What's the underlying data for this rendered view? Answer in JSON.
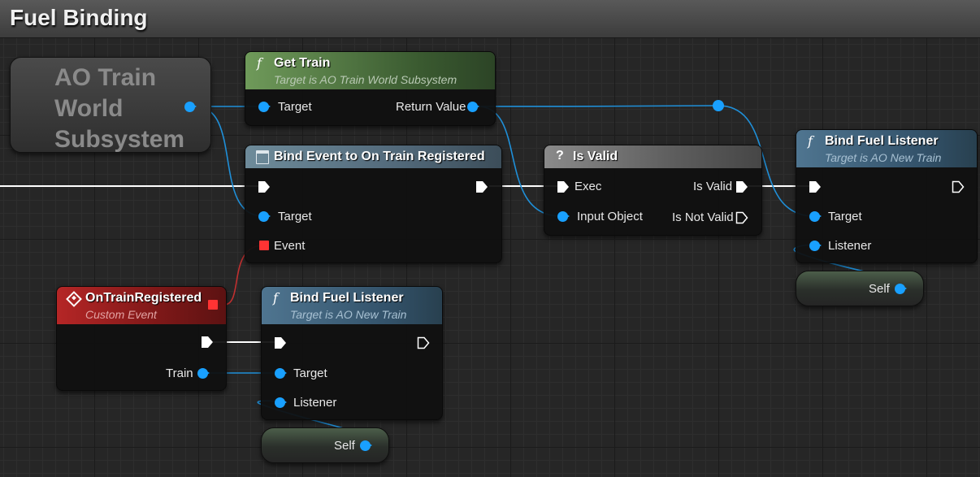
{
  "graph_title": "Fuel Binding",
  "colors": {
    "object_pin": "#19a0ff",
    "exec_pin": "#ffffff",
    "event_pin": "#ff3333",
    "event_header": "#b52626",
    "pure_header": "#6f9a5a",
    "function_header": "#4f7590"
  },
  "icons": {
    "function": "function-icon",
    "delegate": "delegate-icon",
    "question": "question-icon",
    "event": "event-diamond-icon"
  },
  "subsystem_node": {
    "title_lines": [
      "AO Train",
      "World",
      "Subsystem"
    ]
  },
  "get_train": {
    "title": "Get Train",
    "subtitle": "Target is AO Train World Subsystem",
    "pin_target": "Target",
    "pin_return": "Return Value"
  },
  "bind_event": {
    "title": "Bind Event to On Train Registered",
    "pin_target": "Target",
    "pin_event": "Event"
  },
  "is_valid": {
    "title": "Is Valid",
    "pin_exec": "Exec",
    "pin_input": "Input Object",
    "pin_valid": "Is Valid",
    "pin_not_valid": "Is Not Valid"
  },
  "bind_fuel_top": {
    "title": "Bind Fuel Listener",
    "subtitle": "Target is AO New Train",
    "pin_target": "Target",
    "pin_listener": "Listener"
  },
  "custom_event": {
    "title": "OnTrainRegistered",
    "subtitle": "Custom Event",
    "pin_train": "Train"
  },
  "bind_fuel_bottom": {
    "title": "Bind Fuel Listener",
    "subtitle": "Target is AO New Train",
    "pin_target": "Target",
    "pin_listener": "Listener"
  },
  "self_top": {
    "label": "Self"
  },
  "self_bottom": {
    "label": "Self"
  }
}
